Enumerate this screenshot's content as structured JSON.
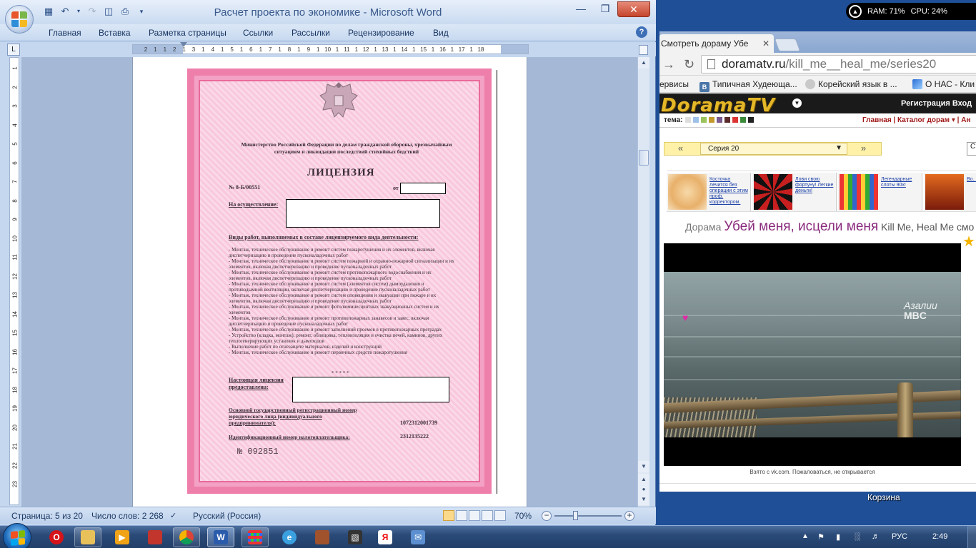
{
  "word": {
    "title": "Расчет проекта по экономике - Microsoft Word",
    "ribbon_tabs": [
      "Главная",
      "Вставка",
      "Разметка страницы",
      "Ссылки",
      "Рассылки",
      "Рецензирование",
      "Вид"
    ],
    "tab_selector": "L",
    "ruler_marks": [
      "2",
      "1",
      "1",
      "2",
      "1",
      "3",
      "1",
      "4",
      "1",
      "5",
      "1",
      "6",
      "1",
      "7",
      "1",
      "8",
      "1",
      "9",
      "1",
      "10",
      "1",
      "11",
      "1",
      "12",
      "1",
      "13",
      "1",
      "14",
      "1",
      "15",
      "1",
      "16",
      "1",
      "17",
      "1",
      "18"
    ],
    "vruler_marks": [
      "1",
      "2",
      "3",
      "4",
      "5",
      "6",
      "7",
      "8",
      "9",
      "10",
      "11",
      "12",
      "13",
      "14",
      "15",
      "16",
      "17",
      "18",
      "19",
      "20",
      "21",
      "22",
      "23"
    ],
    "status": {
      "page": "Страница: 5 из 20",
      "words": "Число слов: 2 268",
      "language": "Русский (Россия)",
      "zoom": "70%"
    }
  },
  "license": {
    "ministry": "Министерство Российской Федерации по делам гражданской обороны, чрезвычайным ситуациям и ликвидации последствий стихийных бедствий",
    "heading": "ЛИЦЕНЗИЯ",
    "number": "№ 8-Б/00551",
    "from_label": "от",
    "activity_label": "На осуществление:",
    "works_heading": "Виды работ, выполняемых в составе лицензируемого вида деятельности:",
    "works": [
      "- Монтаж, техническое обслуживание и ремонт систем пожаротушения и их элементов, включая диспетчеризацию и проведение пусконаладочных работ",
      "- Монтаж, техническое обслуживание и ремонт систем пожарной и охранно-пожарной сигнализации и их элементов, включая диспетчеризацию и проведение пусконаладочных работ",
      "- Монтаж, техническое обслуживание и ремонт систем противопожарного водоснабжения и их элементов, включая диспетчеризацию и проведение пусконаладочных работ",
      "- Монтаж, техническое обслуживание и ремонт систем (элементов систем) дымоудаления и противодымной вентиляции, включая диспетчеризацию и проведение пусконаладочных работ",
      "- Монтаж, техническое обслуживание и ремонт систем оповещения и эвакуации при пожаре и их элементов, включая диспетчеризацию и проведение пусконаладочных работ",
      "- Монтаж, техническое обслуживание и ремонт фотолюминесцентных эвакуационных систем и их элементов",
      "- Монтаж, техническое обслуживание и ремонт противопожарных занавесов и завес, включая диспетчеризацию и проведение пусконаладочных работ",
      "- Монтаж, техническое обслуживание и ремонт заполнений проемов в противопожарных преградах",
      "- Устройство (кладка, монтаж), ремонт, облицовка, теплоизоляция и очистка печей, каминов, других теплогенерирующих установок и дымоходов",
      "- Выполнение работ по огнезащите материалов, изделий и конструкций",
      "- Монтаж, техническое обслуживание и ремонт первичных средств пожаротушения"
    ],
    "stars": "* * * * *",
    "granted_label": "Настоящая лицензия предоставлена:",
    "ogrn_label": "Основной государственный регистрационный номер юридического лица (индивидуального предпринимателя):",
    "ogrn_value": "1072312001739",
    "inn_label": "Идентификационный номер налогоплательщика:",
    "inn_value": "2312135222",
    "serial": "№ 092851"
  },
  "gadget": {
    "ram": "RAM: 71%",
    "cpu": "CPU: 24%"
  },
  "chrome": {
    "tab_title": "Смотреть дораму Убе",
    "url_host": "doramatv.ru",
    "url_path": "/kill_me__heal_me/series20",
    "bookmarks": [
      "ервисы",
      "Типичная Худеюща...",
      "Корейский язык в ...",
      "О НАС - Кли"
    ]
  },
  "site": {
    "logo": "DoramaTV",
    "auth": "Регистрация  Вход",
    "theme_label": "тема:",
    "nav": "Главная | Каталог дорам ▾ | Ан",
    "episode_prev": "«",
    "episode_next": "»",
    "episode_select": "Серия 20",
    "ads": [
      "Косточка лечится без операции с этим проф. корректором.",
      "Лови свою фортуну! Легкие деньги!",
      "Легендарные слоты 90х!",
      "Во..."
    ],
    "title_prefix": "Дорама ",
    "title_ru": "Убей меня, исцели меня",
    "title_en": " Kill Me, Heal Me смо",
    "video_watermark_1": "Азалии",
    "video_watermark_2": "MBC",
    "video_caption": "Взято с vk.com. Пожаловаться, не открывается"
  },
  "desktop": {
    "recycle_label": "Корзина",
    "lang": "РУС",
    "clock": "2:49"
  },
  "colors": {
    "word_chrome": "#c5d7ee",
    "license_pink": "#f3a1c4",
    "taskbar": "#2a4a78",
    "site_accent": "#8a2a7d"
  }
}
